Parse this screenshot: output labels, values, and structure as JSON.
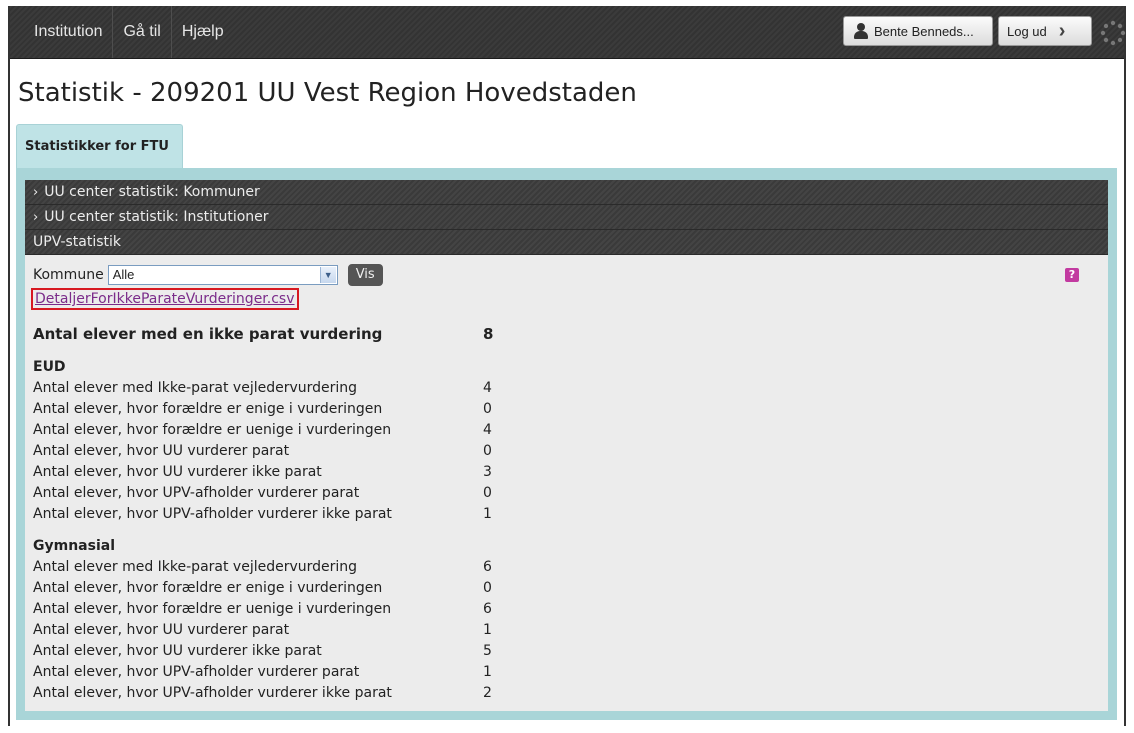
{
  "menu": {
    "items": [
      "Institution",
      "Gå til",
      "Hjælp"
    ]
  },
  "user": {
    "name": "Bente Benneds...",
    "logout_label": "Log ud"
  },
  "page": {
    "title": "Statistik - 209201 UU Vest Region Hovedstaden"
  },
  "tabs": [
    {
      "label": "Statistikker for FTU"
    }
  ],
  "accordion": [
    {
      "label": "UU center statistik: Kommuner",
      "expanded": false
    },
    {
      "label": "UU center statistik: Institutioner",
      "expanded": false
    },
    {
      "label": "UPV-statistik",
      "expanded": true
    }
  ],
  "filter": {
    "label": "Kommune",
    "selected": "Alle",
    "button_label": "Vis"
  },
  "csv_link": "DetaljerForIkkeParateVurderinger.csv",
  "summary": {
    "label": "Antal elever med en ikke parat vurdering",
    "value": "8"
  },
  "sections": [
    {
      "title": "EUD",
      "rows": [
        {
          "label": "Antal elever med Ikke-parat vejledervurdering",
          "value": "4"
        },
        {
          "label": "Antal elever, hvor forældre er enige i vurderingen",
          "value": "0"
        },
        {
          "label": "Antal elever, hvor forældre er uenige i vurderingen",
          "value": "4"
        },
        {
          "label": "Antal elever, hvor UU vurderer parat",
          "value": "0"
        },
        {
          "label": "Antal elever, hvor UU vurderer ikke parat",
          "value": "3"
        },
        {
          "label": "Antal elever, hvor UPV-afholder vurderer parat",
          "value": "0"
        },
        {
          "label": "Antal elever, hvor UPV-afholder vurderer ikke parat",
          "value": "1"
        }
      ]
    },
    {
      "title": "Gymnasial",
      "rows": [
        {
          "label": "Antal elever med Ikke-parat vejledervurdering",
          "value": "6"
        },
        {
          "label": "Antal elever, hvor forældre er enige i vurderingen",
          "value": "0"
        },
        {
          "label": "Antal elever, hvor forældre er uenige i vurderingen",
          "value": "6"
        },
        {
          "label": "Antal elever, hvor UU vurderer parat",
          "value": "1"
        },
        {
          "label": "Antal elever, hvor UU vurderer ikke parat",
          "value": "5"
        },
        {
          "label": "Antal elever, hvor UPV-afholder vurderer parat",
          "value": "1"
        },
        {
          "label": "Antal elever, hvor UPV-afholder vurderer ikke parat",
          "value": "2"
        }
      ]
    }
  ]
}
